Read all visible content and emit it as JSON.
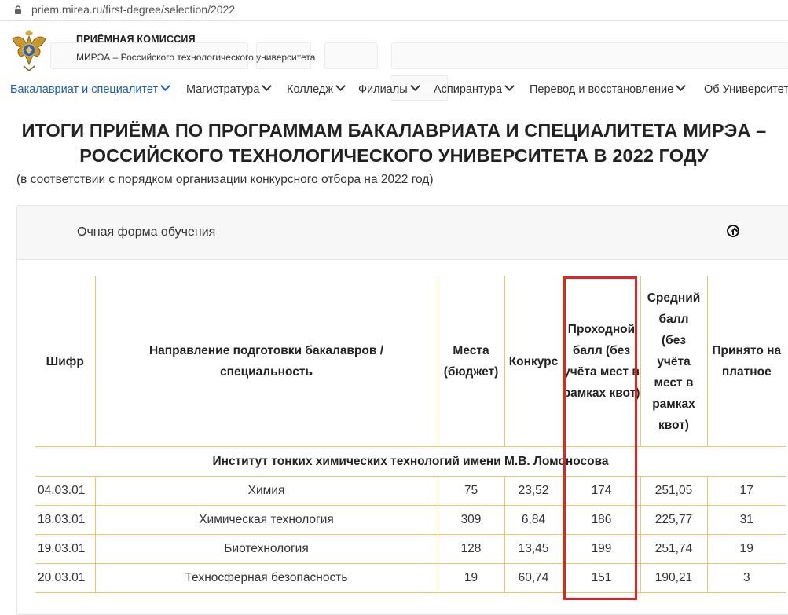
{
  "browser": {
    "url": "priem.mirea.ru/first-degree/selection/2022"
  },
  "header": {
    "org_name": "ПРИЁМНАЯ КОМИССИЯ",
    "org_full": "МИРЭА – Российского технологического университета"
  },
  "nav": {
    "items": [
      {
        "label": "Бакалавриат и специалитет"
      },
      {
        "label": "Магистратура"
      },
      {
        "label": "Колледж"
      },
      {
        "label": "Филиалы"
      },
      {
        "label": "Аспирантура"
      },
      {
        "label": "Перевод и восстановление"
      },
      {
        "label": "Об Университете"
      }
    ]
  },
  "page": {
    "title_line1": "ИТОГИ ПРИЁМА ПО ПРОГРАММАМ БАКАЛАВРИАТА И СПЕЦИАЛИТЕТА МИРЭА –",
    "title_line2": "РОССИЙСКОГО ТЕХНОЛОГИЧЕСКОГО УНИВЕРСИТЕТА В 2022 ГОДУ",
    "subtitle": "(в соответствии с порядком организации конкурсного отбора на 2022 год)"
  },
  "panel": {
    "title": "Очная форма обучения"
  },
  "table": {
    "headers": [
      "Шифр",
      "Направление подготовки бакалавров / специальность",
      "Места (бюджет)",
      "Конкурс",
      "Проходной балл (без учёта мест в рамках квот)",
      "Средний балл (без учёта мест в рамках квот)",
      "Принято на платное"
    ],
    "group": "Институт тонких химических технологий имени М.В. Ломоносова",
    "rows": [
      {
        "code": "04.03.01",
        "name": "Химия",
        "places": "75",
        "competition": "23,52",
        "pass": "174",
        "avg": "251,05",
        "paid": "17"
      },
      {
        "code": "18.03.01",
        "name": "Химическая технология",
        "places": "309",
        "competition": "6,84",
        "pass": "186",
        "avg": "225,77",
        "paid": "31"
      },
      {
        "code": "19.03.01",
        "name": "Биотехнология",
        "places": "128",
        "competition": "13,45",
        "pass": "199",
        "avg": "251,74",
        "paid": "19"
      },
      {
        "code": "20.03.01",
        "name": "Техносферная безопасность",
        "places": "19",
        "competition": "60,74",
        "pass": "151",
        "avg": "190,21",
        "paid": "3"
      }
    ]
  },
  "colors": {
    "table_border": "#f2c36b",
    "highlight": "#e32222",
    "nav_active": "#1a5fb4"
  },
  "icons": {
    "lock": "lock-icon",
    "logo": "eagle-emblem-icon",
    "chevron": "chevron-down-icon",
    "collapse": "arrow-up-circle-icon"
  }
}
